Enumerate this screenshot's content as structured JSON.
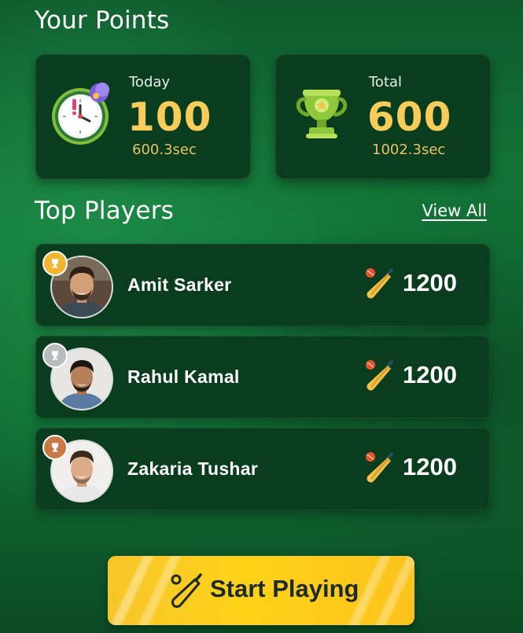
{
  "points": {
    "title": "Your Points",
    "today": {
      "label": "Today",
      "value": "100",
      "time": "600.3sec"
    },
    "total": {
      "label": "Total",
      "value": "600",
      "time": "1002.3sec"
    }
  },
  "top_players": {
    "title": "Top Players",
    "view_all_label": "View All",
    "players": [
      {
        "rank": "gold",
        "name": "Amit Sarker",
        "score": "1200"
      },
      {
        "rank": "silver",
        "name": "Rahul Kamal",
        "score": "1200"
      },
      {
        "rank": "bronze",
        "name": "Zakaria Tushar",
        "score": "1200"
      }
    ]
  },
  "start_button": {
    "label": "Start Playing"
  },
  "colors": {
    "accent_yellow": "#f8cc5a",
    "card_bg": "#0a3d1e",
    "gold": "#f2b632",
    "silver": "#b9bcbd",
    "bronze": "#c97a44"
  }
}
